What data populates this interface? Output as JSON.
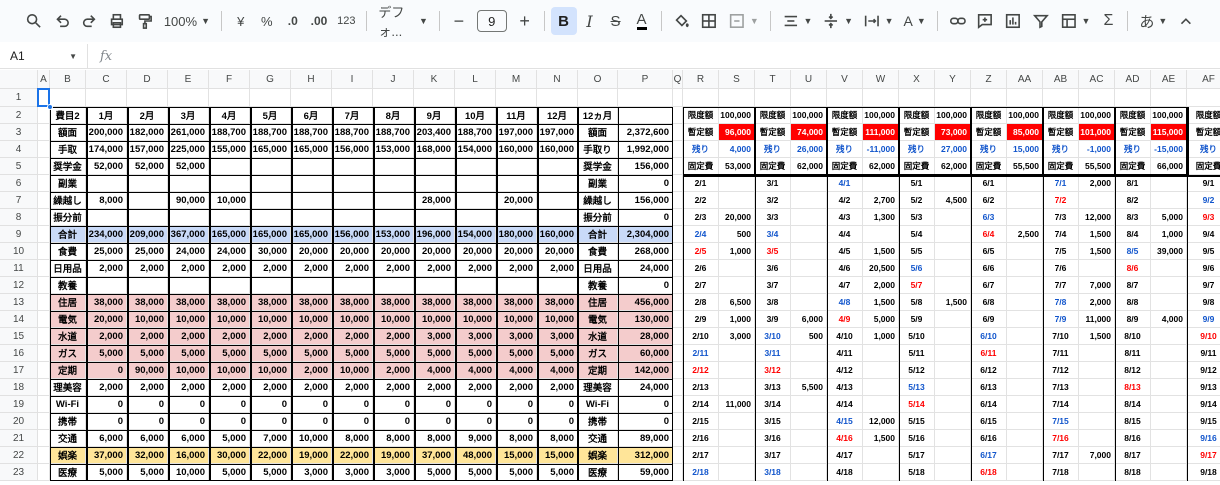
{
  "toolbar": {
    "zoom": "100%",
    "currency": "¥",
    "percent": "%",
    "dec_minus": ".0",
    "dec_plus": ".00",
    "number_format": "123",
    "font": "デフォ...",
    "font_size": "9",
    "ime": "あ"
  },
  "formula_bar": {
    "cell_ref": "A1",
    "fx": "fx",
    "value": ""
  },
  "colors": {
    "blue_fill": "#c9daf8",
    "pink_fill": "#f4cccc",
    "yellow_fill": "#ffe599",
    "red_fill": "#ff0000",
    "red_text": "#ff0000",
    "blue_text": "#1155cc"
  },
  "sheet": {
    "columns": [
      "A",
      "B",
      "C",
      "D",
      "E",
      "F",
      "G",
      "H",
      "I",
      "J",
      "K",
      "L",
      "M",
      "N",
      "O",
      "P",
      "Q",
      "R",
      "S",
      "T",
      "U",
      "V",
      "W",
      "X",
      "Y",
      "Z",
      "AA",
      "AB",
      "AC",
      "AD",
      "AE",
      "AF"
    ],
    "rows": [
      "1",
      "2",
      "3",
      "4",
      "5",
      "6",
      "7",
      "8",
      "9",
      "10",
      "11",
      "12",
      "13",
      "14",
      "15",
      "16",
      "17",
      "18",
      "19",
      "20",
      "21",
      "22",
      "23"
    ],
    "left_rows": [
      [
        "費目2",
        "1月",
        "2月",
        "3月",
        "4月",
        "5月",
        "6月",
        "7月",
        "8月",
        "9月",
        "10月",
        "11月",
        "12月",
        "12ヵ月",
        ""
      ],
      [
        "額面",
        "200,000",
        "182,000",
        "261,000",
        "188,700",
        "188,700",
        "188,700",
        "188,700",
        "188,700",
        "203,400",
        "188,700",
        "197,000",
        "197,000",
        "額面",
        "2,372,600"
      ],
      [
        "手取",
        "174,000",
        "157,000",
        "225,000",
        "155,000",
        "165,000",
        "165,000",
        "156,000",
        "153,000",
        "168,000",
        "154,000",
        "160,000",
        "160,000",
        "手取り",
        "1,992,000"
      ],
      [
        "奨学金",
        "52,000",
        "52,000",
        "52,000",
        "",
        "",
        "",
        "",
        "",
        "",
        "",
        "",
        "",
        "奨学金",
        "156,000"
      ],
      [
        "副業",
        "",
        "",
        "",
        "",
        "",
        "",
        "",
        "",
        "",
        "",
        "",
        "",
        "副業",
        "0"
      ],
      [
        "繰越し",
        "8,000",
        "",
        "90,000",
        "10,000",
        "",
        "",
        "",
        "",
        "28,000",
        "",
        "20,000",
        "",
        "繰越し",
        "156,000"
      ],
      [
        "振分前",
        "",
        "",
        "",
        "",
        "",
        "",
        "",
        "",
        "",
        "",
        "",
        "",
        "振分前",
        "0"
      ],
      [
        "合計",
        "234,000",
        "209,000",
        "367,000",
        "165,000",
        "165,000",
        "165,000",
        "156,000",
        "153,000",
        "196,000",
        "154,000",
        "180,000",
        "160,000",
        "合計",
        "2,304,000"
      ],
      [
        "食費",
        "25,000",
        "25,000",
        "24,000",
        "24,000",
        "30,000",
        "20,000",
        "20,000",
        "20,000",
        "20,000",
        "20,000",
        "20,000",
        "20,000",
        "食費",
        "268,000"
      ],
      [
        "日用品",
        "2,000",
        "2,000",
        "2,000",
        "2,000",
        "2,000",
        "2,000",
        "2,000",
        "2,000",
        "2,000",
        "2,000",
        "2,000",
        "2,000",
        "日用品",
        "24,000"
      ],
      [
        "教養",
        "",
        "",
        "",
        "",
        "",
        "",
        "",
        "",
        "",
        "",
        "",
        "",
        "教養",
        "0"
      ],
      [
        "住居",
        "38,000",
        "38,000",
        "38,000",
        "38,000",
        "38,000",
        "38,000",
        "38,000",
        "38,000",
        "38,000",
        "38,000",
        "38,000",
        "38,000",
        "住居",
        "456,000"
      ],
      [
        "電気",
        "20,000",
        "10,000",
        "10,000",
        "10,000",
        "10,000",
        "10,000",
        "10,000",
        "10,000",
        "10,000",
        "10,000",
        "10,000",
        "10,000",
        "電気",
        "130,000"
      ],
      [
        "水道",
        "2,000",
        "2,000",
        "2,000",
        "2,000",
        "2,000",
        "2,000",
        "2,000",
        "2,000",
        "3,000",
        "3,000",
        "3,000",
        "3,000",
        "水道",
        "28,000"
      ],
      [
        "ガス",
        "5,000",
        "5,000",
        "5,000",
        "5,000",
        "5,000",
        "5,000",
        "5,000",
        "5,000",
        "5,000",
        "5,000",
        "5,000",
        "5,000",
        "ガス",
        "60,000"
      ],
      [
        "定期",
        "0",
        "90,000",
        "10,000",
        "10,000",
        "10,000",
        "2,000",
        "10,000",
        "2,000",
        "4,000",
        "4,000",
        "4,000",
        "4,000",
        "定期",
        "142,000"
      ],
      [
        "理美容",
        "2,000",
        "2,000",
        "2,000",
        "2,000",
        "2,000",
        "2,000",
        "2,000",
        "2,000",
        "2,000",
        "2,000",
        "2,000",
        "2,000",
        "理美容",
        "24,000"
      ],
      [
        "Wi-Fi",
        "0",
        "0",
        "0",
        "0",
        "0",
        "0",
        "0",
        "0",
        "0",
        "0",
        "0",
        "0",
        "Wi-Fi",
        "0"
      ],
      [
        "携帯",
        "0",
        "0",
        "0",
        "0",
        "0",
        "0",
        "0",
        "0",
        "0",
        "0",
        "0",
        "0",
        "携帯",
        "0"
      ],
      [
        "交通",
        "6,000",
        "6,000",
        "6,000",
        "5,000",
        "7,000",
        "10,000",
        "8,000",
        "8,000",
        "8,000",
        "9,000",
        "8,000",
        "8,000",
        "交通",
        "89,000"
      ],
      [
        "娯楽",
        "37,000",
        "32,000",
        "16,000",
        "30,000",
        "22,000",
        "19,000",
        "22,000",
        "19,000",
        "37,000",
        "48,000",
        "15,000",
        "15,000",
        "娯楽",
        "312,000"
      ],
      [
        "医療",
        "5,000",
        "5,000",
        "10,000",
        "5,000",
        "5,000",
        "3,000",
        "3,000",
        "3,000",
        "5,000",
        "5,000",
        "5,000",
        "5,000",
        "医療",
        "59,000"
      ]
    ],
    "right_header": [
      [
        "限度額",
        "100,000"
      ],
      [
        "限度額",
        "100,000"
      ],
      [
        "限度額",
        "100,000"
      ],
      [
        "限度額",
        "100,000"
      ],
      [
        "限度額",
        "100,000"
      ],
      [
        "限度額",
        "100,000"
      ],
      [
        "限度額",
        "100,000"
      ],
      [
        "限度額",
        "100,000"
      ],
      [
        "限度額",
        ""
      ]
    ],
    "right_zantei": [
      [
        "暫定額",
        "96,000"
      ],
      [
        "暫定額",
        "74,000"
      ],
      [
        "暫定額",
        "111,000"
      ],
      [
        "暫定額",
        "73,000"
      ],
      [
        "暫定額",
        "85,000"
      ],
      [
        "暫定額",
        "101,000"
      ],
      [
        "暫定額",
        "115,000"
      ],
      [
        "暫定額",
        "11"
      ],
      [
        "暫定額",
        ""
      ]
    ],
    "right_nokori": [
      [
        "残り",
        "4,000"
      ],
      [
        "残り",
        "26,000"
      ],
      [
        "残り",
        "-11,000"
      ],
      [
        "残り",
        "27,000"
      ],
      [
        "残り",
        "15,000"
      ],
      [
        "残り",
        "-1,000"
      ],
      [
        "残り",
        "-15,000"
      ],
      [
        "残り",
        "-1"
      ],
      [
        "残り",
        ""
      ]
    ],
    "right_kotei": [
      [
        "固定費",
        "53,000"
      ],
      [
        "固定費",
        "62,000"
      ],
      [
        "固定費",
        "62,000"
      ],
      [
        "固定費",
        "62,000"
      ],
      [
        "固定費",
        "55,500"
      ],
      [
        "固定費",
        "55,500"
      ],
      [
        "固定費",
        "66,000"
      ],
      [
        "固定費",
        "65,"
      ],
      [
        "固定費",
        ""
      ]
    ],
    "days": [
      [
        [
          "2/1",
          ""
        ],
        [
          "2/2",
          ""
        ],
        [
          "2/3",
          "20,000"
        ],
        [
          "2/4",
          "500"
        ],
        [
          "2/5",
          "1,000"
        ],
        [
          "2/6",
          ""
        ],
        [
          "2/7",
          ""
        ],
        [
          "2/8",
          "6,500"
        ],
        [
          "2/9",
          "1,000"
        ],
        [
          "2/10",
          "3,000"
        ],
        [
          "2/11",
          ""
        ],
        [
          "2/12",
          ""
        ],
        [
          "2/13",
          ""
        ],
        [
          "2/14",
          "11,000"
        ],
        [
          "2/15",
          ""
        ],
        [
          "2/16",
          ""
        ],
        [
          "2/17",
          ""
        ],
        [
          "2/18",
          ""
        ]
      ],
      [
        [
          "3/1",
          ""
        ],
        [
          "3/2",
          ""
        ],
        [
          "3/3",
          ""
        ],
        [
          "3/4",
          ""
        ],
        [
          "3/5",
          ""
        ],
        [
          "3/6",
          ""
        ],
        [
          "3/7",
          ""
        ],
        [
          "3/8",
          ""
        ],
        [
          "3/9",
          "6,000"
        ],
        [
          "3/10",
          "500"
        ],
        [
          "3/11",
          ""
        ],
        [
          "3/12",
          ""
        ],
        [
          "3/13",
          "5,500"
        ],
        [
          "3/14",
          ""
        ],
        [
          "3/15",
          ""
        ],
        [
          "3/16",
          ""
        ],
        [
          "3/17",
          ""
        ],
        [
          "3/18",
          ""
        ]
      ],
      [
        [
          "4/1",
          ""
        ],
        [
          "4/2",
          "2,700"
        ],
        [
          "4/3",
          "1,300"
        ],
        [
          "4/4",
          ""
        ],
        [
          "4/5",
          "1,500"
        ],
        [
          "4/6",
          "20,500"
        ],
        [
          "4/7",
          "2,000"
        ],
        [
          "4/8",
          "1,500"
        ],
        [
          "4/9",
          "5,000"
        ],
        [
          "4/10",
          "1,000"
        ],
        [
          "4/11",
          ""
        ],
        [
          "4/12",
          ""
        ],
        [
          "4/13",
          ""
        ],
        [
          "4/14",
          ""
        ],
        [
          "4/15",
          "12,000"
        ],
        [
          "4/16",
          "1,500"
        ],
        [
          "4/17",
          ""
        ],
        [
          "4/18",
          ""
        ]
      ],
      [
        [
          "5/1",
          ""
        ],
        [
          "5/2",
          "4,500"
        ],
        [
          "5/3",
          ""
        ],
        [
          "5/4",
          ""
        ],
        [
          "5/5",
          ""
        ],
        [
          "5/6",
          ""
        ],
        [
          "5/7",
          ""
        ],
        [
          "5/8",
          "1,500"
        ],
        [
          "5/9",
          ""
        ],
        [
          "5/10",
          ""
        ],
        [
          "5/11",
          ""
        ],
        [
          "5/12",
          ""
        ],
        [
          "5/13",
          ""
        ],
        [
          "5/14",
          ""
        ],
        [
          "5/15",
          ""
        ],
        [
          "5/16",
          ""
        ],
        [
          "5/17",
          ""
        ],
        [
          "5/18",
          ""
        ]
      ],
      [
        [
          "6/1",
          ""
        ],
        [
          "6/2",
          ""
        ],
        [
          "6/3",
          ""
        ],
        [
          "6/4",
          "2,500"
        ],
        [
          "6/5",
          ""
        ],
        [
          "6/6",
          ""
        ],
        [
          "6/7",
          ""
        ],
        [
          "6/8",
          ""
        ],
        [
          "6/9",
          ""
        ],
        [
          "6/10",
          ""
        ],
        [
          "6/11",
          ""
        ],
        [
          "6/12",
          ""
        ],
        [
          "6/13",
          ""
        ],
        [
          "6/14",
          ""
        ],
        [
          "6/15",
          ""
        ],
        [
          "6/16",
          ""
        ],
        [
          "6/17",
          ""
        ],
        [
          "6/18",
          ""
        ]
      ],
      [
        [
          "7/1",
          "2,000"
        ],
        [
          "7/2",
          ""
        ],
        [
          "7/3",
          "12,000"
        ],
        [
          "7/4",
          "1,500"
        ],
        [
          "7/5",
          "1,500"
        ],
        [
          "7/6",
          ""
        ],
        [
          "7/7",
          "7,000"
        ],
        [
          "7/8",
          "2,000"
        ],
        [
          "7/9",
          "11,000"
        ],
        [
          "7/10",
          "1,500"
        ],
        [
          "7/11",
          ""
        ],
        [
          "7/12",
          ""
        ],
        [
          "7/13",
          ""
        ],
        [
          "7/14",
          ""
        ],
        [
          "7/15",
          ""
        ],
        [
          "7/16",
          ""
        ],
        [
          "7/17",
          "7,000"
        ],
        [
          "7/18",
          ""
        ]
      ],
      [
        [
          "8/1",
          ""
        ],
        [
          "8/2",
          ""
        ],
        [
          "8/3",
          "5,000"
        ],
        [
          "8/4",
          "1,000"
        ],
        [
          "8/5",
          "39,000"
        ],
        [
          "8/6",
          ""
        ],
        [
          "8/7",
          ""
        ],
        [
          "8/8",
          ""
        ],
        [
          "8/9",
          "4,000"
        ],
        [
          "8/10",
          ""
        ],
        [
          "8/11",
          ""
        ],
        [
          "8/12",
          ""
        ],
        [
          "8/13",
          ""
        ],
        [
          "8/14",
          ""
        ],
        [
          "8/15",
          ""
        ],
        [
          "8/16",
          ""
        ],
        [
          "8/17",
          ""
        ],
        [
          "8/18",
          ""
        ]
      ],
      [
        [
          "9/1",
          ""
        ],
        [
          "9/2",
          ""
        ],
        [
          "9/3",
          ""
        ],
        [
          "9/4",
          ""
        ],
        [
          "9/5",
          ""
        ],
        [
          "9/6",
          ""
        ],
        [
          "9/7",
          ""
        ],
        [
          "9/8",
          ""
        ],
        [
          "9/9",
          ""
        ],
        [
          "9/10",
          ""
        ],
        [
          "9/11",
          ""
        ],
        [
          "9/12",
          ""
        ],
        [
          "9/13",
          ""
        ],
        [
          "9/14",
          ""
        ],
        [
          "9/15",
          ""
        ],
        [
          "9/16",
          ""
        ],
        [
          "9/17",
          ""
        ],
        [
          "9/18",
          ""
        ]
      ]
    ],
    "day_colors": [
      [
        "",
        "",
        "",
        "b",
        "r",
        "",
        "",
        "",
        "",
        "",
        "b",
        "r",
        "",
        "",
        "",
        "",
        "",
        "b"
      ],
      [
        "",
        "",
        "",
        "b",
        "r",
        "",
        "",
        "",
        "",
        "b",
        "b",
        "r",
        "",
        "",
        "",
        "",
        "",
        "b"
      ],
      [
        "b",
        "",
        "",
        "",
        "",
        "",
        "",
        "b",
        "r",
        "",
        "",
        "",
        "",
        "",
        "b",
        "r",
        "",
        ""
      ],
      [
        "",
        "",
        "",
        "",
        "",
        "b",
        "r",
        "",
        "",
        "",
        "",
        "",
        "b",
        "r",
        "",
        "",
        "",
        ""
      ],
      [
        "",
        "",
        "b",
        "r",
        "",
        "",
        "",
        "",
        "",
        "b",
        "r",
        "",
        "",
        "",
        "",
        "",
        "b",
        "r"
      ],
      [
        "b",
        "r",
        "",
        "",
        "",
        "",
        "",
        "b",
        "b",
        "",
        "",
        "",
        "",
        "",
        "b",
        "r",
        "",
        ""
      ],
      [
        "",
        "",
        "",
        "",
        "b",
        "r",
        "",
        "",
        "",
        "",
        "",
        "",
        "r",
        "",
        "",
        "",
        "",
        ""
      ],
      [
        "",
        "b",
        "r",
        "",
        "",
        "",
        "",
        "",
        "b",
        "r",
        "",
        "",
        "",
        "",
        "",
        "b",
        "r",
        ""
      ]
    ]
  }
}
